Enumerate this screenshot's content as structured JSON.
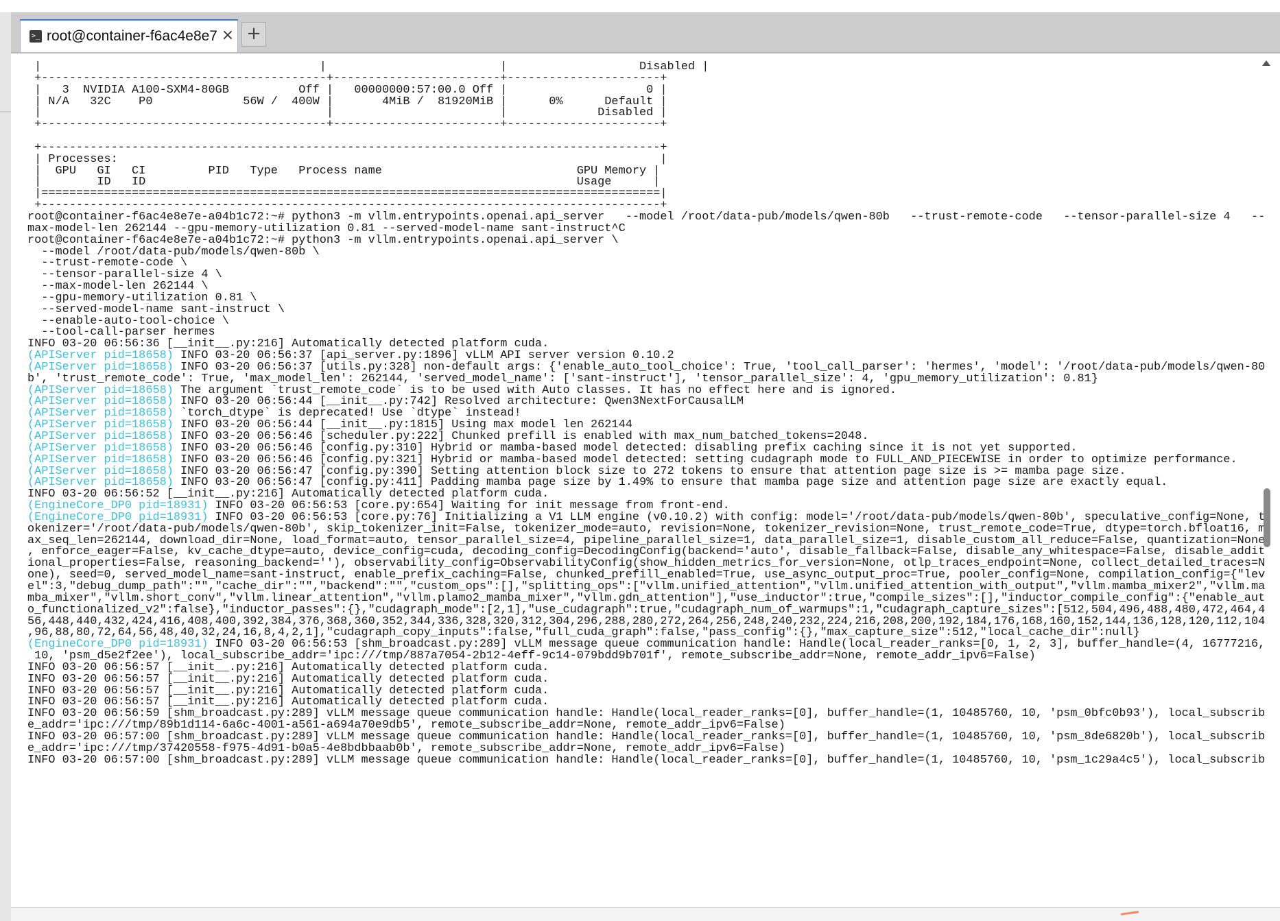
{
  "window": {
    "tab_title": "root@container-f6ac4e8e7",
    "tab_close_icon": "×",
    "new_tab_icon": "+",
    "terminal_icon_glyph": ">_"
  },
  "prefix_color": "#3cc0e0",
  "terminal": {
    "lines": [
      {
        "text": " |                                        |                         |                   Disabled |"
      },
      {
        "text": " +-----------------------------------------+------------------------+----------------------+"
      },
      {
        "text": " |   3  NVIDIA A100-SXM4-80GB          Off |   00000000:57:00.0 Off |                    0 |"
      },
      {
        "text": " | N/A   32C    P0             56W /  400W |       4MiB /  81920MiB |      0%      Default |"
      },
      {
        "text": " |                                         |                        |             Disabled |"
      },
      {
        "text": " +-----------------------------------------+------------------------+----------------------+"
      },
      {
        "text": ""
      },
      {
        "text": " +-----------------------------------------------------------------------------------------+"
      },
      {
        "text": " | Processes:                                                                              |"
      },
      {
        "text": " |  GPU   GI   CI         PID   Type   Process name                            GPU Memory |"
      },
      {
        "text": " |        ID   ID                                                              Usage      |"
      },
      {
        "text": " |=========================================================================================|"
      },
      {
        "text": " +-----------------------------------------------------------------------------------------+"
      },
      {
        "text": "root@container-f6ac4e8e7e-a04b1c72:~# python3 -m vllm.entrypoints.openai.api_server   --model /root/data-pub/models/qwen-80b   --trust-remote-code   --tensor-parallel-size 4   --"
      },
      {
        "text": "max-model-len 262144 --gpu-memory-utilization 0.81 --served-model-name sant-instruct^C"
      },
      {
        "text": "root@container-f6ac4e8e7e-a04b1c72:~# python3 -m vllm.entrypoints.openai.api_server \\"
      },
      {
        "text": "  --model /root/data-pub/models/qwen-80b \\"
      },
      {
        "text": "  --trust-remote-code \\"
      },
      {
        "text": "  --tensor-parallel-size 4 \\"
      },
      {
        "text": "  --max-model-len 262144 \\"
      },
      {
        "text": "  --gpu-memory-utilization 0.81 \\"
      },
      {
        "text": "  --served-model-name sant-instruct \\"
      },
      {
        "text": "  --enable-auto-tool-choice \\"
      },
      {
        "text": "  --tool-call-parser hermes"
      },
      {
        "text": "INFO 03-20 06:56:36 [__init__.py:216] Automatically detected platform cuda."
      },
      {
        "prefix": "(APIServer pid=18658)",
        "text": " INFO 03-20 06:56:37 [api_server.py:1896] vLLM API server version 0.10.2"
      },
      {
        "prefix": "(APIServer pid=18658)",
        "text": " INFO 03-20 06:56:37 [utils.py:328] non-default args: {'enable_auto_tool_choice': True, 'tool_call_parser': 'hermes', 'model': '/root/data-pub/models/qwen-80"
      },
      {
        "text": "b', 'trust_remote_code': True, 'max_model_len': 262144, 'served_model_name': ['sant-instruct'], 'tensor_parallel_size': 4, 'gpu_memory_utilization': 0.81}"
      },
      {
        "prefix": "(APIServer pid=18658)",
        "text": " The argument `trust_remote_code` is to be used with Auto classes. It has no effect here and is ignored."
      },
      {
        "prefix": "(APIServer pid=18658)",
        "text": " INFO 03-20 06:56:44 [__init__.py:742] Resolved architecture: Qwen3NextForCausalLM"
      },
      {
        "prefix": "(APIServer pid=18658)",
        "text": " `torch_dtype` is deprecated! Use `dtype` instead!"
      },
      {
        "prefix": "(APIServer pid=18658)",
        "text": " INFO 03-20 06:56:44 [__init__.py:1815] Using max model len 262144"
      },
      {
        "prefix": "(APIServer pid=18658)",
        "text": " INFO 03-20 06:56:46 [scheduler.py:222] Chunked prefill is enabled with max_num_batched_tokens=2048."
      },
      {
        "prefix": "(APIServer pid=18658)",
        "text": " INFO 03-20 06:56:46 [config.py:310] Hybrid or mamba-based model detected: disabling prefix caching since it is not yet supported."
      },
      {
        "prefix": "(APIServer pid=18658)",
        "text": " INFO 03-20 06:56:46 [config.py:321] Hybrid or mamba-based model detected: setting cudagraph mode to FULL_AND_PIECEWISE in order to optimize performance."
      },
      {
        "prefix": "(APIServer pid=18658)",
        "text": " INFO 03-20 06:56:47 [config.py:390] Setting attention block size to 272 tokens to ensure that attention page size is >= mamba page size."
      },
      {
        "prefix": "(APIServer pid=18658)",
        "text": " INFO 03-20 06:56:47 [config.py:411] Padding mamba page size by 1.49% to ensure that mamba page size and attention page size are exactly equal."
      },
      {
        "text": "INFO 03-20 06:56:52 [__init__.py:216] Automatically detected platform cuda."
      },
      {
        "prefix": "(EngineCore_DP0 pid=18931)",
        "text": " INFO 03-20 06:56:53 [core.py:654] Waiting for init message from front-end."
      },
      {
        "prefix": "(EngineCore_DP0 pid=18931)",
        "text": " INFO 03-20 06:56:53 [core.py:76] Initializing a V1 LLM engine (v0.10.2) with config: model='/root/data-pub/models/qwen-80b', speculative_config=None, t"
      },
      {
        "text": "okenizer='/root/data-pub/models/qwen-80b', skip_tokenizer_init=False, tokenizer_mode=auto, revision=None, tokenizer_revision=None, trust_remote_code=True, dtype=torch.bfloat16, m"
      },
      {
        "text": "ax_seq_len=262144, download_dir=None, load_format=auto, tensor_parallel_size=4, pipeline_parallel_size=1, data_parallel_size=1, disable_custom_all_reduce=False, quantization=None"
      },
      {
        "text": ", enforce_eager=False, kv_cache_dtype=auto, device_config=cuda, decoding_config=DecodingConfig(backend='auto', disable_fallback=False, disable_any_whitespace=False, disable_addit"
      },
      {
        "text": "ional_properties=False, reasoning_backend=''), observability_config=ObservabilityConfig(show_hidden_metrics_for_version=None, otlp_traces_endpoint=None, collect_detailed_traces=N"
      },
      {
        "text": "one), seed=0, served_model_name=sant-instruct, enable_prefix_caching=False, chunked_prefill_enabled=True, use_async_output_proc=True, pooler_config=None, compilation_config={\"lev"
      },
      {
        "text": "el\":3,\"debug_dump_path\":\"\",\"cache_dir\":\"\",\"backend\":\"\",\"custom_ops\":[],\"splitting_ops\":[\"vllm.unified_attention\",\"vllm.unified_attention_with_output\",\"vllm.mamba_mixer2\",\"vllm.ma"
      },
      {
        "text": "mba_mixer\",\"vllm.short_conv\",\"vllm.linear_attention\",\"vllm.plamo2_mamba_mixer\",\"vllm.gdn_attention\"],\"use_inductor\":true,\"compile_sizes\":[],\"inductor_compile_config\":{\"enable_aut"
      },
      {
        "text": "o_functionalized_v2\":false},\"inductor_passes\":{},\"cudagraph_mode\":[2,1],\"use_cudagraph\":true,\"cudagraph_num_of_warmups\":1,\"cudagraph_capture_sizes\":[512,504,496,488,480,472,464,4"
      },
      {
        "text": "56,448,440,432,424,416,408,400,392,384,376,368,360,352,344,336,328,320,312,304,296,288,280,272,264,256,248,240,232,224,216,208,200,192,184,176,168,160,152,144,136,128,120,112,104"
      },
      {
        "text": ",96,88,80,72,64,56,48,40,32,24,16,8,4,2,1],\"cudagraph_copy_inputs\":false,\"full_cuda_graph\":false,\"pass_config\":{},\"max_capture_size\":512,\"local_cache_dir\":null}"
      },
      {
        "prefix": "(EngineCore_DP0 pid=18931)",
        "text": " INFO 03-20 06:56:53 [shm_broadcast.py:289] vLLM message queue communication handle: Handle(local_reader_ranks=[0, 1, 2, 3], buffer_handle=(4, 16777216,"
      },
      {
        "text": " 10, 'psm_d5e2f2ee'), local_subscribe_addr='ipc:///tmp/887a7054-2b12-4eff-9c14-079bdd9b701f', remote_subscribe_addr=None, remote_addr_ipv6=False)"
      },
      {
        "text": "INFO 03-20 06:56:57 [__init__.py:216] Automatically detected platform cuda."
      },
      {
        "text": "INFO 03-20 06:56:57 [__init__.py:216] Automatically detected platform cuda."
      },
      {
        "text": "INFO 03-20 06:56:57 [__init__.py:216] Automatically detected platform cuda."
      },
      {
        "text": "INFO 03-20 06:56:57 [__init__.py:216] Automatically detected platform cuda."
      },
      {
        "text": "INFO 03-20 06:56:59 [shm_broadcast.py:289] vLLM message queue communication handle: Handle(local_reader_ranks=[0], buffer_handle=(1, 10485760, 10, 'psm_0bfc0b93'), local_subscrib"
      },
      {
        "text": "e_addr='ipc:///tmp/89b1d114-6a6c-4001-a561-a694a70e9db5', remote_subscribe_addr=None, remote_addr_ipv6=False)"
      },
      {
        "text": "INFO 03-20 06:57:00 [shm_broadcast.py:289] vLLM message queue communication handle: Handle(local_reader_ranks=[0], buffer_handle=(1, 10485760, 10, 'psm_8de6820b'), local_subscrib"
      },
      {
        "text": "e_addr='ipc:///tmp/37420558-f975-4d91-b0a5-4e8bdbbaab0b', remote_subscribe_addr=None, remote_addr_ipv6=False)"
      },
      {
        "text": "INFO 03-20 06:57:00 [shm_broadcast.py:289] vLLM message queue communication handle: Handle(local_reader_ranks=[0], buffer_handle=(1, 10485760, 10, 'psm_1c29a4c5'), local_subscrib"
      }
    ]
  }
}
